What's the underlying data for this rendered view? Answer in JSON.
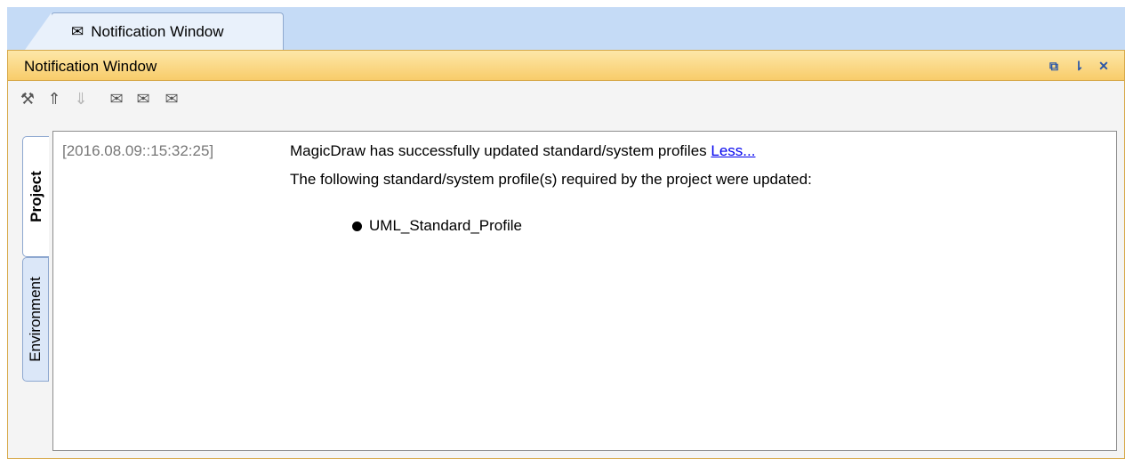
{
  "tab": {
    "label": "Notification Window",
    "icon": "envelope-icon"
  },
  "panel": {
    "title": "Notification Window"
  },
  "window_controls": [
    {
      "name": "restore-icon",
      "glyph": "⧉"
    },
    {
      "name": "pin-icon",
      "glyph": "⇂"
    },
    {
      "name": "close-icon",
      "glyph": "✕"
    }
  ],
  "toolbar": [
    {
      "name": "tools-icon",
      "glyph": "⚒",
      "enabled": true
    },
    {
      "name": "move-up-icon",
      "glyph": "⇑",
      "enabled": true
    },
    {
      "name": "move-down-icon",
      "glyph": "⇓",
      "enabled": false
    },
    {
      "name": "mail-delete-icon",
      "glyph": "✉",
      "enabled": true
    },
    {
      "name": "mail-open-icon",
      "glyph": "✉",
      "enabled": true
    },
    {
      "name": "mail-clock-icon",
      "glyph": "✉",
      "enabled": true
    }
  ],
  "side_tabs": [
    {
      "label": "Project",
      "active": true
    },
    {
      "label": "Environment",
      "active": false
    }
  ],
  "notification": {
    "timestamp": "[2016.08.09::15:32:25]",
    "message": "MagicDraw has successfully updated standard/system profiles ",
    "link": "Less...",
    "detail": "The following standard/system profile(s) required by the project were updated:",
    "items": [
      "UML_Standard_Profile"
    ]
  },
  "colors": {
    "header_bar": "#c5dbf6",
    "title_gradient_top": "#fde7a8",
    "title_gradient_bottom": "#f8cc6a",
    "link": "#0000ee"
  }
}
